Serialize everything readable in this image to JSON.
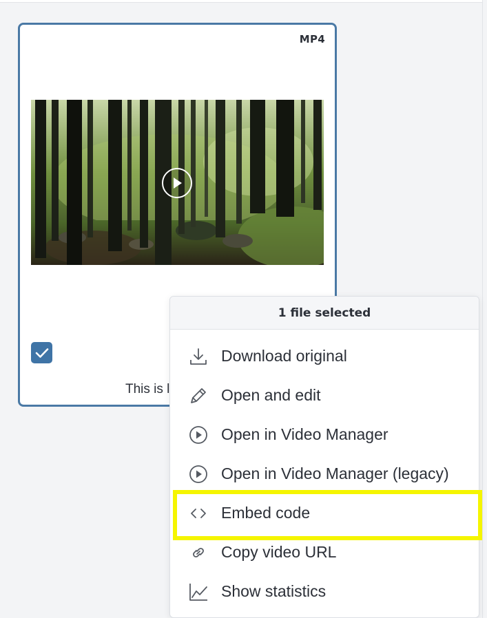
{
  "card": {
    "file_type": "MP4",
    "caption": "This is l",
    "selected": true,
    "border_color": "#4a79a5",
    "checkbox_color": "#3f74a6"
  },
  "thumbnail": {
    "icon": "play-circle-icon"
  },
  "context_menu": {
    "header": "1 file selected",
    "items": [
      {
        "label": "Download original",
        "icon": "download-icon"
      },
      {
        "label": "Open and edit",
        "icon": "pencil-icon"
      },
      {
        "label": "Open in Video Manager",
        "icon": "play-circle-icon"
      },
      {
        "label": "Open in Video Manager (legacy)",
        "icon": "play-circle-icon"
      },
      {
        "label": "Embed code",
        "icon": "code-brackets-icon",
        "highlighted": true
      },
      {
        "label": "Copy video URL",
        "icon": "link-icon"
      },
      {
        "label": "Show statistics",
        "icon": "line-chart-icon"
      }
    ]
  },
  "highlight_color": "#f5f500"
}
